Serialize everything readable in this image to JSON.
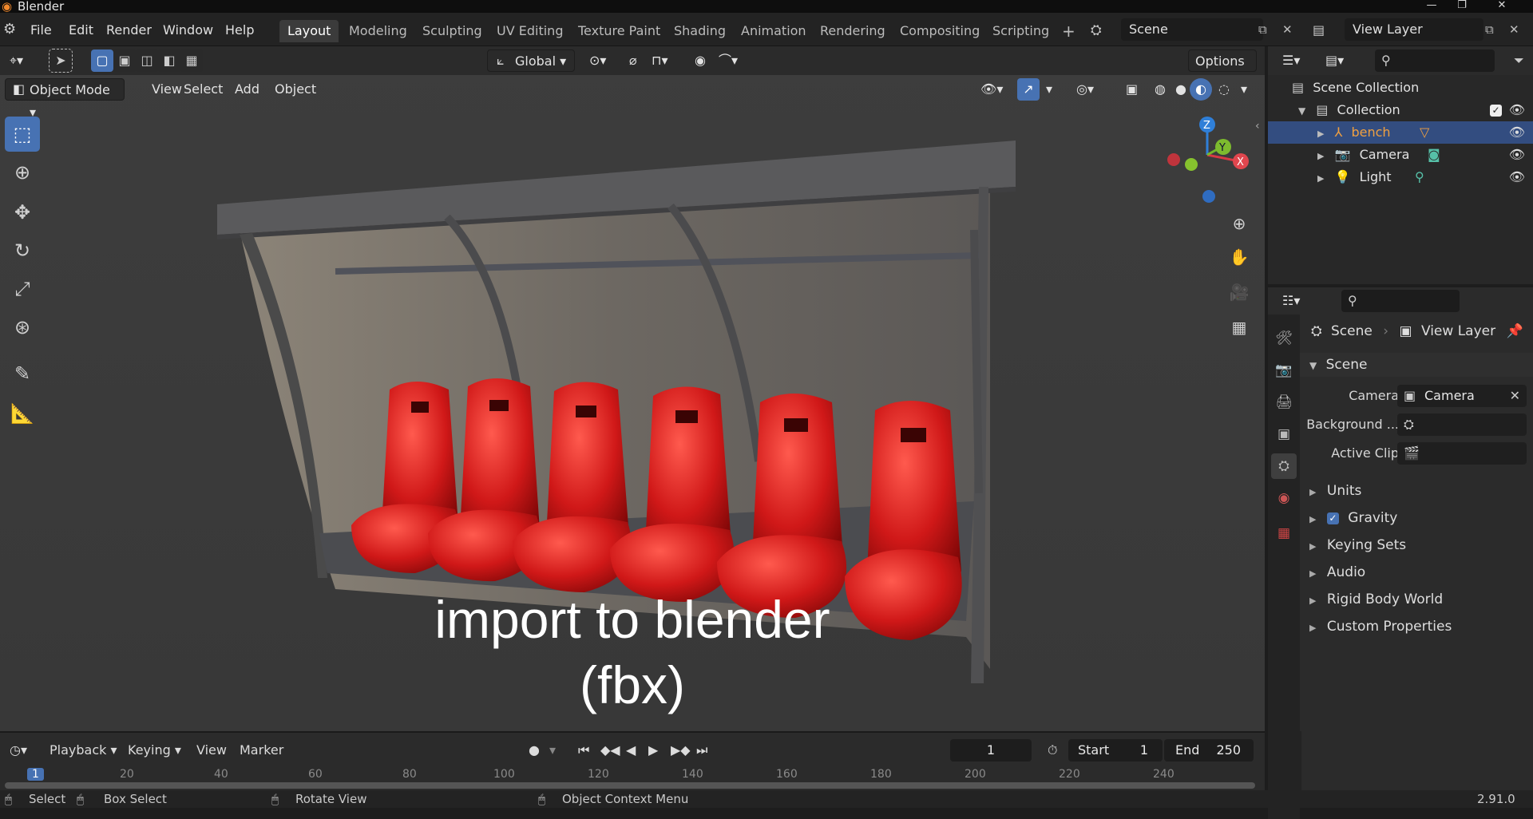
{
  "window": {
    "title": "Blender"
  },
  "menu": [
    "File",
    "Edit",
    "Render",
    "Window",
    "Help"
  ],
  "workspaces": [
    "Layout",
    "Modeling",
    "Sculpting",
    "UV Editing",
    "Texture Paint",
    "Shading",
    "Animation",
    "Rendering",
    "Compositing",
    "Scripting"
  ],
  "scene_field": "Scene",
  "view_layer_field": "View Layer",
  "viewport": {
    "transform_orientation": "Global",
    "options_label": "Options",
    "mode": "Object Mode",
    "header_menu": [
      "View",
      "Select",
      "Add",
      "Object"
    ],
    "overlay_text_line1": "import to blender",
    "overlay_text_line2": "(fbx)",
    "gizmo": {
      "z": "Z",
      "y": "Y",
      "x": "X"
    }
  },
  "outliner": {
    "root": "Scene Collection",
    "collection": "Collection",
    "items": [
      {
        "name": "bench",
        "selected": true
      },
      {
        "name": "Camera",
        "selected": false
      },
      {
        "name": "Light",
        "selected": false
      }
    ]
  },
  "properties": {
    "breadcrumb_scene": "Scene",
    "breadcrumb_view_layer": "View Layer",
    "panel_title": "Scene",
    "camera_label": "Camera",
    "camera_value": "Camera",
    "background_label": "Background ...",
    "active_clip_label": "Active Clip",
    "sections": [
      "Units",
      "Gravity",
      "Keying Sets",
      "Audio",
      "Rigid Body World",
      "Custom Properties"
    ],
    "gravity_checked": true
  },
  "timeline": {
    "menus": [
      "Playback",
      "Keying",
      "View",
      "Marker"
    ],
    "current_frame": "1",
    "start_label": "Start",
    "start_value": "1",
    "end_label": "End",
    "end_value": "250",
    "ruler_ticks": [
      "1",
      "20",
      "40",
      "60",
      "80",
      "100",
      "120",
      "140",
      "160",
      "180",
      "200",
      "220",
      "240"
    ]
  },
  "statusbar": {
    "select": "Select",
    "box_select": "Box Select",
    "rotate_view": "Rotate View",
    "context_menu": "Object Context Menu",
    "version": "2.91.0"
  },
  "colors": {
    "accent": "#4772b3",
    "seat": "#d01818",
    "selected_row": "#334d80",
    "bench_label": "#f0a040"
  }
}
